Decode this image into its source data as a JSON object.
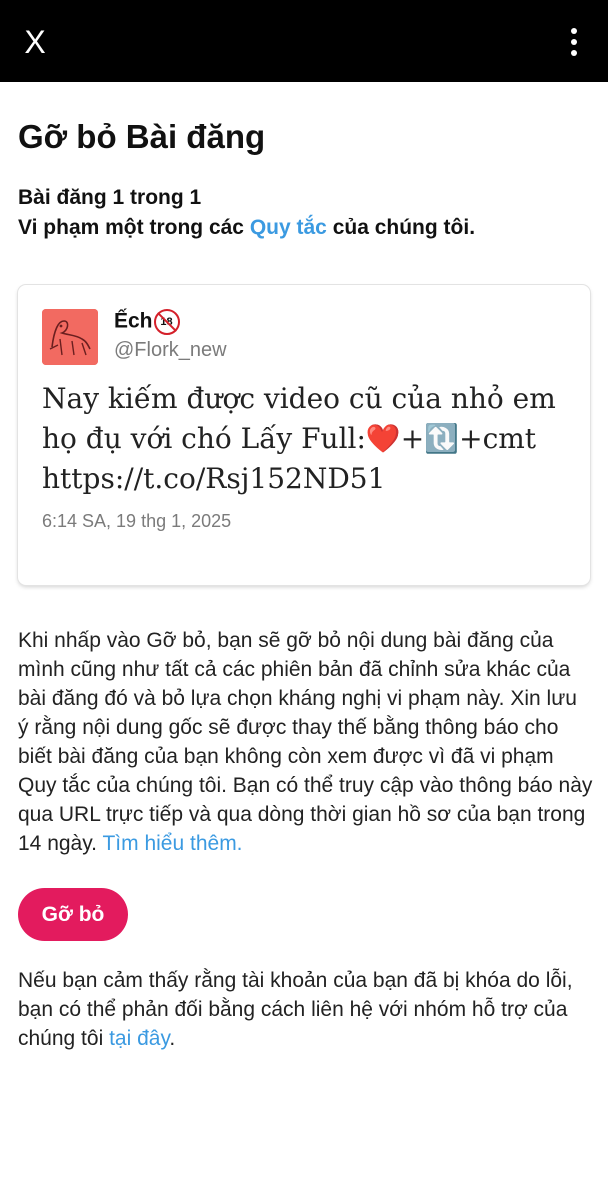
{
  "topbar": {
    "close_glyph": "X",
    "close_icon": "close-icon",
    "menu_icon": "more-vertical-icon"
  },
  "page": {
    "title": "Gỡ bỏ Bài đăng",
    "post_count": "Bài đăng 1 trong 1",
    "violation_prefix": "Vi phạm một trong các ",
    "violation_link": "Quy tắc",
    "violation_suffix": " của chúng tôi."
  },
  "post": {
    "display_name": "Ếch",
    "badge": "18",
    "handle": "@Flork_new",
    "text_line1": "Nay kiếm được video cũ của nhỏ em",
    "text_line2": "họ đụ với chó Lấy Full:❤️+🔃+cmt",
    "text_line3": "https://t.co/Rsj152ND51",
    "timestamp": "6:14 SA, 19 thg 1, 2025"
  },
  "explanation": {
    "text": "Khi nhấp vào Gỡ bỏ, bạn sẽ gỡ bỏ nội dung bài đăng của mình cũng như tất cả các phiên bản đã chỉnh sửa khác của bài đăng đó và bỏ lựa chọn kháng nghị vi phạm này. Xin lưu ý rằng nội dung gốc sẽ được thay thế bằng thông báo cho biết bài đăng của bạn không còn xem được vì đã vi phạm Quy tắc của chúng tôi. Bạn có thể truy cập vào thông báo này qua URL trực tiếp và qua dòng thời gian hồ sơ của bạn trong 14 ngày. ",
    "learn_more": "Tìm hiểu thêm."
  },
  "actions": {
    "remove_label": "Gỡ bỏ"
  },
  "appeal": {
    "text": "Nếu bạn cảm thấy rằng tài khoản của bạn đã bị khóa do lỗi, bạn có thể phản đối bằng cách liên hệ với nhóm hỗ trợ của chúng tôi ",
    "link": "tại đây",
    "suffix": "."
  },
  "colors": {
    "topbar": "#000000",
    "link": "#3b9ae1",
    "remove_button": "#e31b5e",
    "avatar": "#f26a61"
  }
}
